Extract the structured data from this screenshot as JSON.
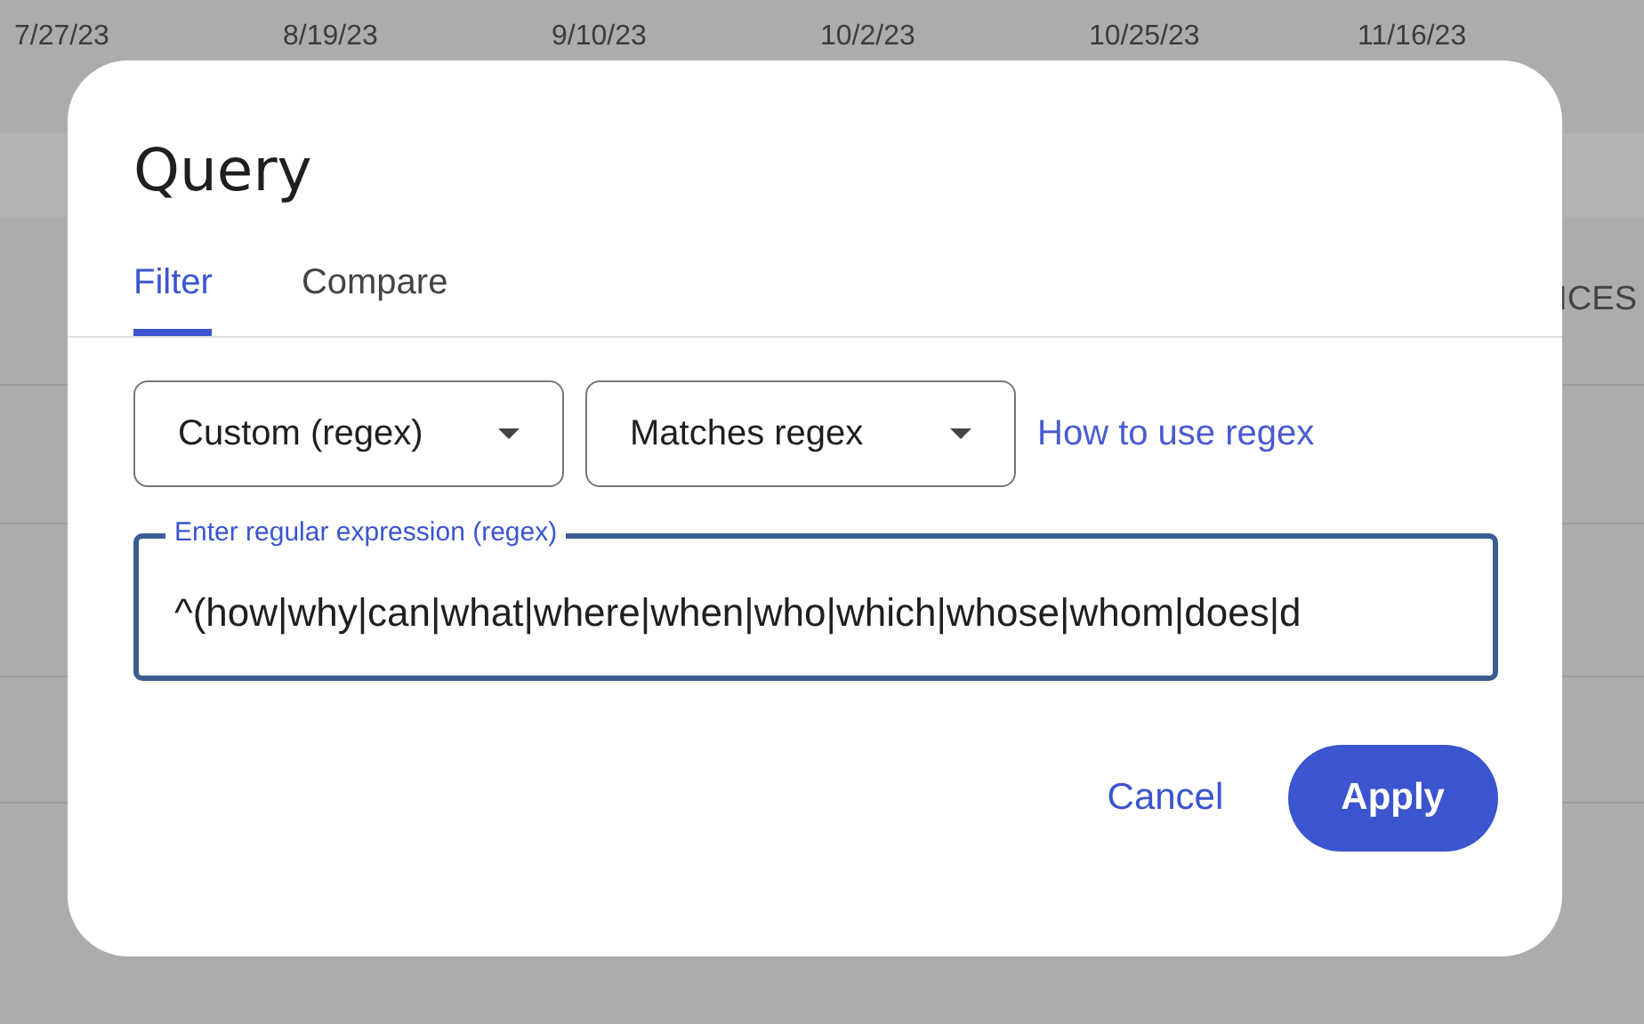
{
  "background": {
    "axis_labels": [
      "7/27/23",
      "8/19/23",
      "9/10/23",
      "10/2/23",
      "10/25/23",
      "11/16/23"
    ],
    "column_header": "ICES"
  },
  "dialog": {
    "title": "Query",
    "tabs": [
      {
        "label": "Filter",
        "selected": true
      },
      {
        "label": "Compare",
        "selected": false
      }
    ],
    "selects": [
      {
        "value": "Custom (regex)"
      },
      {
        "value": "Matches regex"
      }
    ],
    "help_link": "How to use regex",
    "regex_field": {
      "label": "Enter regular expression (regex)",
      "value": "^(how|why|can|what|where|when|who|which|whose|whom|does|d"
    },
    "buttons": [
      {
        "label": "Cancel",
        "kind": "text"
      },
      {
        "label": "Apply",
        "kind": "filled"
      }
    ]
  }
}
